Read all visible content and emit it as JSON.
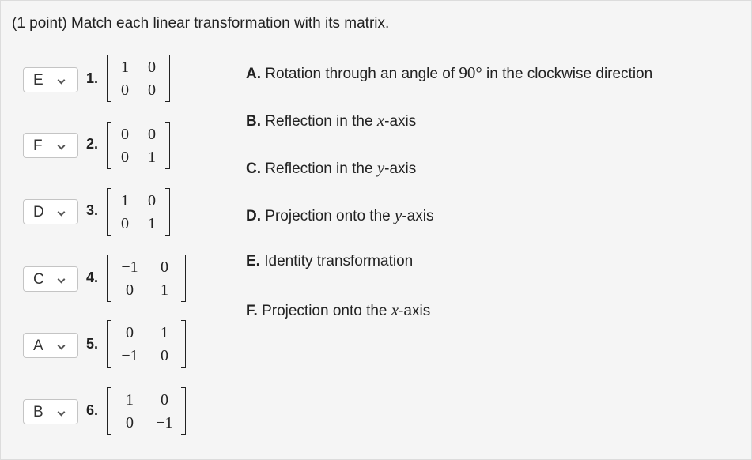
{
  "prompt": "(1 point) Match each linear transformation with its matrix.",
  "rows": [
    {
      "selected": "E",
      "number": "1.",
      "matrix": [
        [
          "1",
          "0"
        ],
        [
          "0",
          "0"
        ]
      ]
    },
    {
      "selected": "F",
      "number": "2.",
      "matrix": [
        [
          "0",
          "0"
        ],
        [
          "0",
          "1"
        ]
      ]
    },
    {
      "selected": "D",
      "number": "3.",
      "matrix": [
        [
          "1",
          "0"
        ],
        [
          "0",
          "1"
        ]
      ]
    },
    {
      "selected": "C",
      "number": "4.",
      "matrix": [
        [
          "−1",
          "0"
        ],
        [
          "0",
          "1"
        ]
      ]
    },
    {
      "selected": "A",
      "number": "5.",
      "matrix": [
        [
          "0",
          "1"
        ],
        [
          "−1",
          "0"
        ]
      ]
    },
    {
      "selected": "B",
      "number": "6.",
      "matrix": [
        [
          "1",
          "0"
        ],
        [
          "0",
          "−1"
        ]
      ]
    }
  ],
  "options": [
    {
      "label": "A.",
      "pre": "Rotation through an angle of ",
      "math": "90°",
      "post": " in the clockwise direction"
    },
    {
      "label": "B.",
      "pre": "Reflection in the ",
      "math": "x",
      "post": "-axis"
    },
    {
      "label": "C.",
      "pre": "Reflection in the ",
      "math": "y",
      "post": "-axis"
    },
    {
      "label": "D.",
      "pre": "Projection onto the ",
      "math": "y",
      "post": "-axis"
    },
    {
      "label": "E.",
      "pre": "Identity transformation",
      "math": "",
      "post": ""
    },
    {
      "label": "F.",
      "pre": "Projection onto the ",
      "math": "x",
      "post": "-axis"
    }
  ]
}
